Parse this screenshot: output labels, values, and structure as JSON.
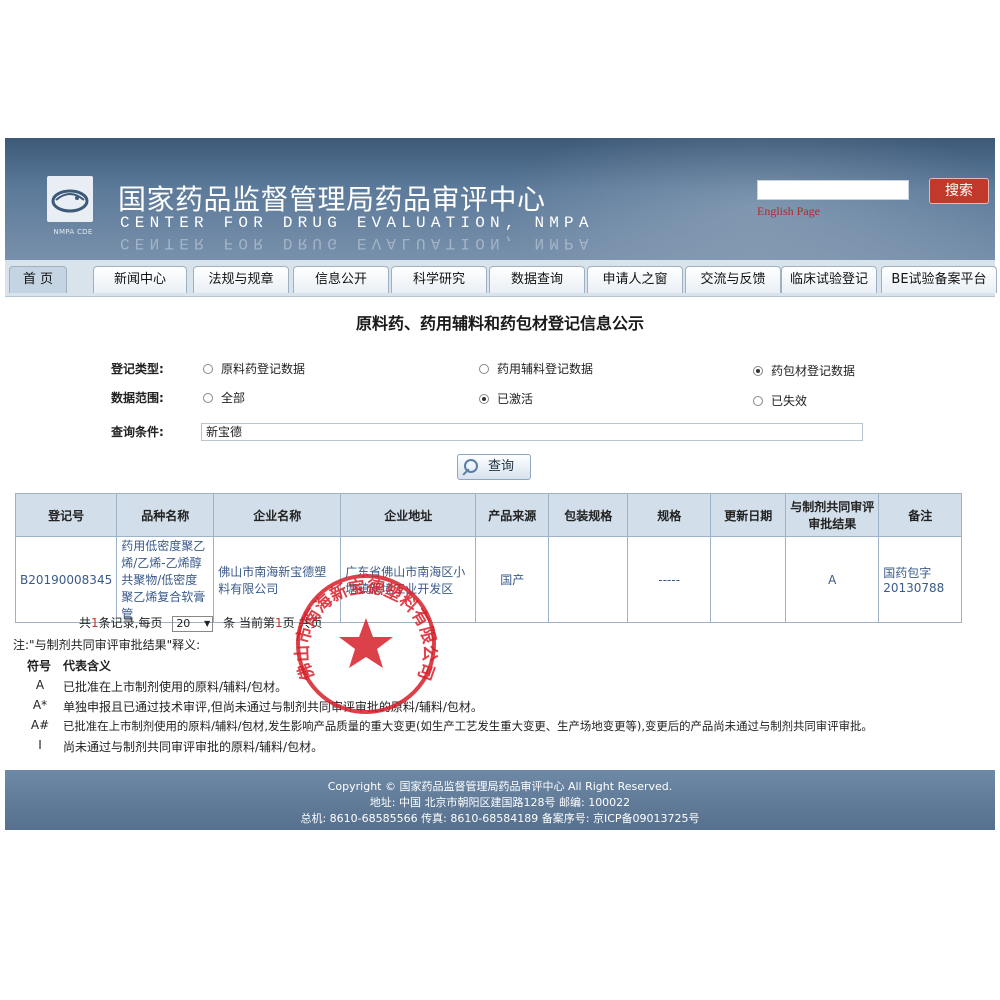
{
  "header": {
    "logo_caption": "NMPA CDE",
    "title_cn": "国家药品监督管理局药品审评中心",
    "title_en": "CENTER FOR DRUG EVALUATION, NMPA",
    "search_button": "搜索",
    "english_link": "English Page"
  },
  "nav": [
    "首 页",
    "新闻中心",
    "法规与规章",
    "信息公开",
    "科学研究",
    "数据查询",
    "申请人之窗",
    "交流与反馈",
    "临床试验登记",
    "BE试验备案平台"
  ],
  "page_title": "原料药、药用辅料和药包材登记信息公示",
  "filters": {
    "type_label": "登记类型:",
    "type_options": [
      "原料药登记数据",
      "药用辅料登记数据",
      "药包材登记数据"
    ],
    "type_selected": "药包材登记数据",
    "scope_label": "数据范围:",
    "scope_options": [
      "全部",
      "已激活",
      "已失效"
    ],
    "scope_selected": "已激活",
    "query_label": "查询条件:",
    "query_value": "新宝德",
    "query_button": "查询"
  },
  "table": {
    "headers": [
      "登记号",
      "品种名称",
      "企业名称",
      "企业地址",
      "产品来源",
      "包装规格",
      "规格",
      "更新日期",
      "与制剂共同审评审批结果",
      "备注"
    ],
    "rows": [
      [
        "B20190008345",
        "药用低密度聚乙烯/乙烯-乙烯醇共聚物/低密度聚乙烯复合软膏管",
        "佛山市南海新宝德塑料有限公司",
        "广东省佛山市南海区小塘镇新境工业开发区",
        "国产",
        "",
        "-----",
        "",
        "A",
        "国药包字20130788"
      ]
    ]
  },
  "pager": {
    "prefix": "共",
    "records": "1",
    "records_suffix": "条记录,每页",
    "page_size": "20",
    "current_prefix": "条 当前第",
    "current": "1",
    "total_prefix": "页 共",
    "total_tail": "页"
  },
  "notes": {
    "intro": "注:\"与制剂共同审评审批结果\"释义:",
    "col_symbol": "符号",
    "col_meaning": "代表含义",
    "items": [
      {
        "symbol": "A",
        "text": "已批准在上市制剂使用的原料/辅料/包材。"
      },
      {
        "symbol": "A*",
        "text": "单独申报且已通过技术审评,但尚未通过与制剂共同审评审批的原料/辅料/包材。"
      },
      {
        "symbol": "A#",
        "text": "已批准在上市制剂使用的原料/辅料/包材,发生影响产品质量的重大变更(如生产工艺发生重大变更、生产场地变更等),变更后的产品尚未通过与制剂共同审评审批。"
      },
      {
        "symbol": "I",
        "text": "尚未通过与制剂共同审评审批的原料/辅料/包材。"
      }
    ]
  },
  "footer": {
    "copyright": "Copyright © 国家药品监督管理局药品审评中心   All Right Reserved.",
    "address": "地址: 中国 北京市朝阳区建国路128号    邮编: 100022",
    "contact": "总机: 8610-68585566    传真: 8610-68584189    备案序号: 京ICP备09013725号"
  },
  "stamp": {
    "text": "佛山市南海新宝德塑料有限公司"
  },
  "colors": {
    "banner": "#4b6888",
    "table_header": "#d2dfeb",
    "link_text": "#3a5a8a",
    "stamp_red": "#d6202a"
  }
}
